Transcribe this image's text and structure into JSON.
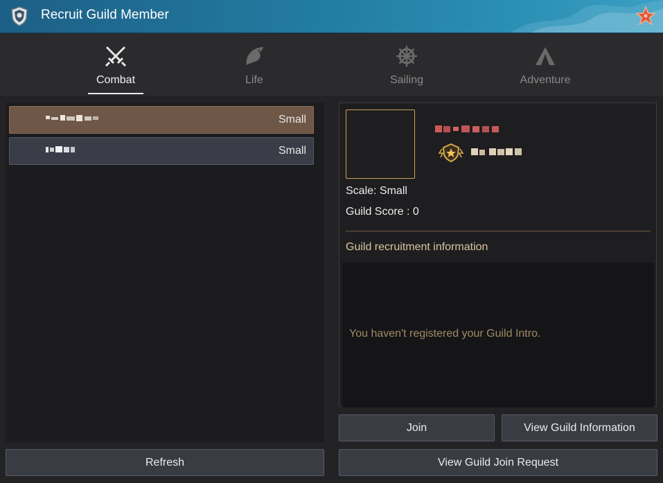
{
  "window": {
    "title": "Recruit Guild Member"
  },
  "icons": {
    "title": "guild-shield-icon",
    "close": "starfish-close-icon"
  },
  "tabs": [
    {
      "label": "Combat",
      "icon": "crossed-swords-icon",
      "active": true
    },
    {
      "label": "Life",
      "icon": "fish-icon",
      "active": false
    },
    {
      "label": "Sailing",
      "icon": "ship-wheel-icon",
      "active": false
    },
    {
      "label": "Adventure",
      "icon": "tent-icon",
      "active": false
    }
  ],
  "guild_list": [
    {
      "name": "",
      "scale": "Small",
      "selected": true
    },
    {
      "name": "",
      "scale": "Small",
      "selected": false
    }
  ],
  "buttons": {
    "refresh": "Refresh",
    "join": "Join",
    "view_info": "View Guild Information",
    "view_request": "View Guild Join Request"
  },
  "detail": {
    "scale_line": "Scale: Small",
    "score_line": "Guild Score : 0",
    "recruit_label": "Guild recruitment information",
    "intro_text": "You haven't registered your Guild Intro.",
    "master_icon": "guild-master-rank-icon"
  },
  "colors": {
    "accent_title": "#227aa0",
    "selected_row": "#6e5746",
    "emblem_border": "#c9a15a",
    "guild_name": "#c85a5a",
    "intro_text": "#a08a66"
  }
}
